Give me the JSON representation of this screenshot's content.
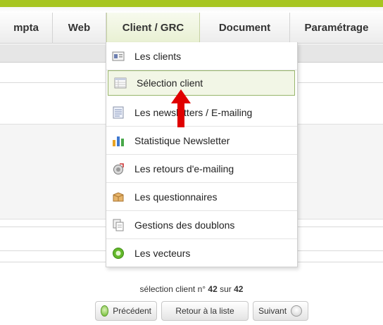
{
  "nav": {
    "tabs": [
      {
        "label": "mpta"
      },
      {
        "label": "Web"
      },
      {
        "label": "Client / GRC",
        "active": true
      },
      {
        "label": "Document"
      },
      {
        "label": "Paramétrage"
      }
    ]
  },
  "menu": {
    "items": [
      {
        "label": "Les clients",
        "icon": "client-card-icon"
      },
      {
        "label": "Sélection client",
        "icon": "table-grid-icon",
        "highlighted": true
      },
      {
        "label": "Les newsletters / E-mailing",
        "icon": "document-lines-icon"
      },
      {
        "label": "Statistique Newsletter",
        "icon": "bar-chart-icon"
      },
      {
        "label": "Les retours d'e-mailing",
        "icon": "email-return-icon"
      },
      {
        "label": "Les questionnaires",
        "icon": "box-icon"
      },
      {
        "label": "Gestions des doublons",
        "icon": "duplicate-pages-icon"
      },
      {
        "label": "Les vecteurs",
        "icon": "green-circle-icon"
      }
    ]
  },
  "pager": {
    "prefix": "sélection client n° ",
    "current": "42",
    "middle": " sur ",
    "total": "42",
    "prev_label": "Précédent",
    "back_label": "Retour à la liste",
    "next_label": "Suivant"
  },
  "colors": {
    "brand_green": "#a7c521",
    "highlight_border": "#98b56b",
    "arrow_red": "#e00000"
  }
}
